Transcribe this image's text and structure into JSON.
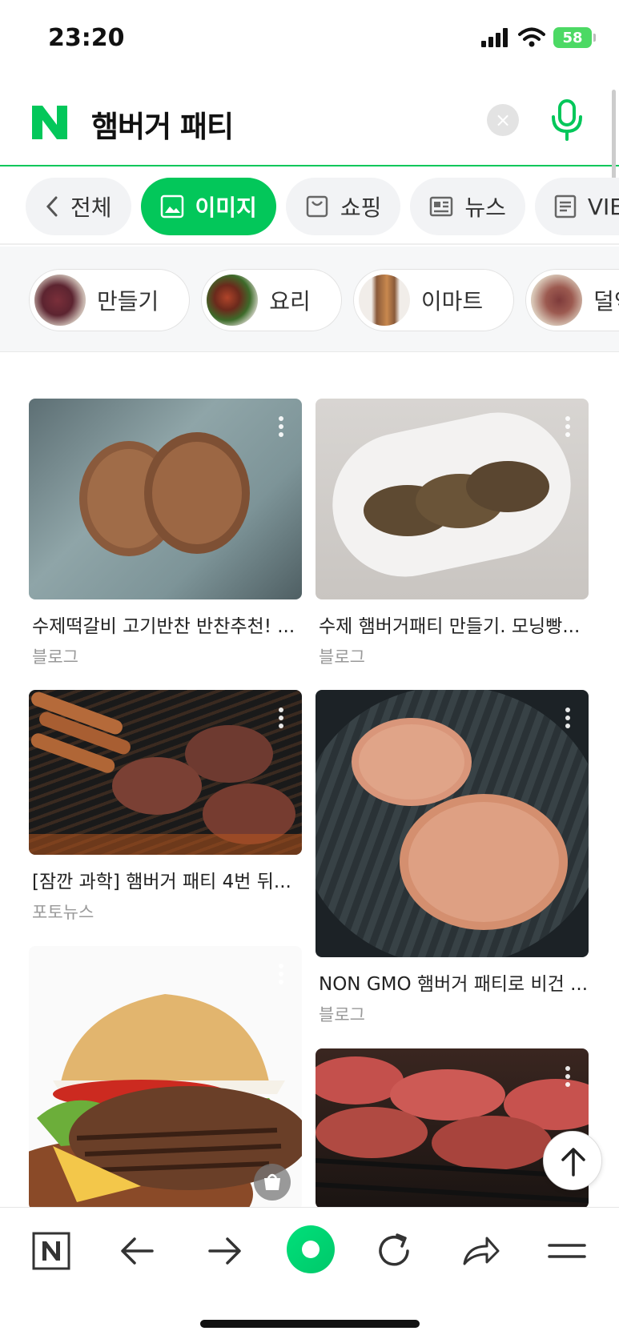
{
  "status_bar": {
    "time": "23:20",
    "battery": "58"
  },
  "search": {
    "query": "햄버거 패티",
    "clear_label": "×"
  },
  "tabs": [
    {
      "label": "전체",
      "icon": "chevron-left-icon"
    },
    {
      "label": "이미지",
      "icon": "image-icon",
      "active": true
    },
    {
      "label": "쇼핑",
      "icon": "shopping-bag-icon"
    },
    {
      "label": "뉴스",
      "icon": "news-icon"
    },
    {
      "label": "VIEW",
      "icon": "document-icon"
    }
  ],
  "related_chips": [
    {
      "label": "만들기"
    },
    {
      "label": "요리"
    },
    {
      "label": "이마트"
    },
    {
      "label": "덜익음"
    }
  ],
  "results": [
    {
      "title": "수제떡갈비 고기반찬 반찬추천! ...",
      "source": "블로그"
    },
    {
      "title": "수제 햄버거패티 만들기. 모닝빵...",
      "source": "블로그"
    },
    {
      "title": "[잠깐 과학] 햄버거 패티 4번 뒤...",
      "source": "포토뉴스"
    },
    {
      "title": "NON GMO 햄버거 패티로 비건 ...",
      "source": "블로그"
    },
    {
      "title": "",
      "source": ""
    },
    {
      "title": "",
      "source": ""
    }
  ],
  "colors": {
    "brand": "#03c75a",
    "active_tab_bg": "#03c75a"
  }
}
